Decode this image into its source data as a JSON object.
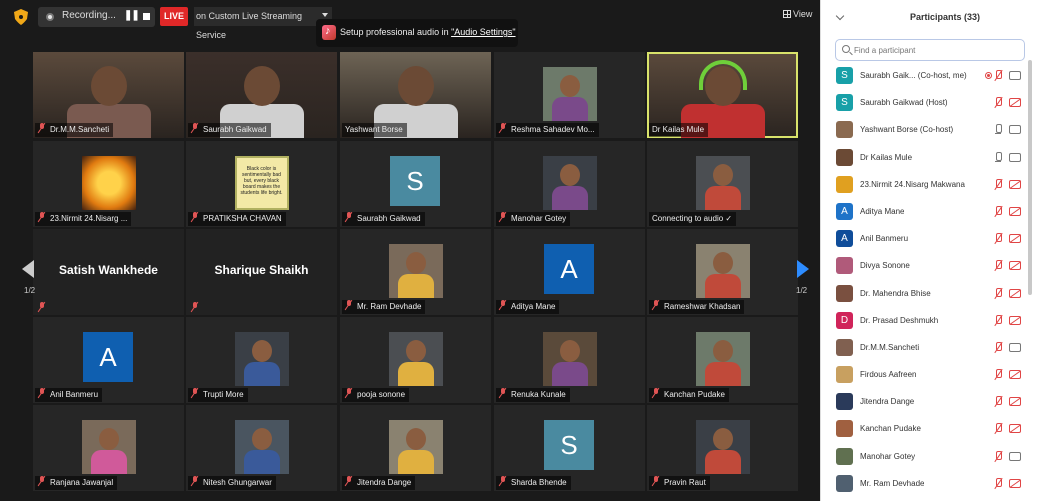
{
  "topbar": {
    "recording_label": "Recording...",
    "live_badge": "LIVE",
    "live_service": "on Custom Live Streaming Service",
    "audio_tip_prefix": "Setup professional audio in",
    "audio_tip_link": "\"Audio Settings\"",
    "view_label": "View"
  },
  "grid": {
    "page_label": "1/2",
    "tiles": [
      {
        "name": "Dr.M.M.Sancheti",
        "kind": "video"
      },
      {
        "name": "Saurabh Gaikwad",
        "kind": "video"
      },
      {
        "name": "Yashwant Borse",
        "kind": "video"
      },
      {
        "name": "Reshma Sahadev Mo...",
        "kind": "photo"
      },
      {
        "name": "Dr Kailas Mule",
        "kind": "video",
        "active": true
      },
      {
        "name": "23.Nirmit 24.Nisarg ...",
        "kind": "photo"
      },
      {
        "name": "PRATIKSHA CHAVAN",
        "kind": "photo"
      },
      {
        "name": "Saurabh Gaikwad",
        "kind": "letter",
        "letter": "S"
      },
      {
        "name": "Manohar Gotey",
        "kind": "photo"
      },
      {
        "name": "Connecting to audio ✓",
        "kind": "photo"
      },
      {
        "name": "Satish Wankhede",
        "kind": "bigname"
      },
      {
        "name": "Sharique Shaikh",
        "kind": "bigname"
      },
      {
        "name": "Mr. Ram Devhade",
        "kind": "photo"
      },
      {
        "name": "Aditya Mane",
        "kind": "letter",
        "letter": "A"
      },
      {
        "name": "Rameshwar Khadsan",
        "kind": "photo"
      },
      {
        "name": "Anil Banmeru",
        "kind": "letter",
        "letter": "A"
      },
      {
        "name": "Trupti More",
        "kind": "photo"
      },
      {
        "name": "pooja sonone",
        "kind": "photo"
      },
      {
        "name": "Renuka Kunale",
        "kind": "photo"
      },
      {
        "name": "Kanchan Pudake",
        "kind": "photo"
      },
      {
        "name": "Ranjana Jawanjal",
        "kind": "photo"
      },
      {
        "name": "Nitesh Ghungarwar",
        "kind": "photo"
      },
      {
        "name": "Jitendra Dange",
        "kind": "photo"
      },
      {
        "name": "Sharda Bhende",
        "kind": "letter",
        "letter": "S"
      },
      {
        "name": "Pravin Raut",
        "kind": "photo"
      }
    ],
    "pratiksha_board_text": "Black color is sentimentally bad but, every black board makes the students life bright."
  },
  "panel": {
    "title": "Participants (33)",
    "search_placeholder": "Find a participant",
    "participants": [
      {
        "name": "Saurabh Gaik...  (Co-host, me)",
        "avatar": "S",
        "avatar_color": "#18a0a8",
        "mic": "red",
        "cam": "gray",
        "rec": true
      },
      {
        "name": "Saurabh Gaikwad (Host)",
        "avatar": "S",
        "avatar_color": "#18a0a8",
        "mic": "red",
        "cam": "red"
      },
      {
        "name": "Yashwant Borse (Co-host)",
        "avatar": "",
        "avatar_color": "#8a6a50",
        "mic": "gray",
        "cam": "gray"
      },
      {
        "name": "Dr Kailas Mule",
        "avatar": "",
        "avatar_color": "#6b4a35",
        "mic": "gray",
        "cam": "gray"
      },
      {
        "name": "23.Nirmit 24.Nisarg Makwana",
        "avatar": "",
        "avatar_color": "#e0a020",
        "mic": "red",
        "cam": "red"
      },
      {
        "name": "Aditya Mane",
        "avatar": "A",
        "avatar_color": "#1e73c8",
        "mic": "red",
        "cam": "red"
      },
      {
        "name": "Anil Banmeru",
        "avatar": "A",
        "avatar_color": "#0f4d9a",
        "mic": "red",
        "cam": "red"
      },
      {
        "name": "Divya Sonone",
        "avatar": "",
        "avatar_color": "#b05a7a",
        "mic": "red",
        "cam": "red"
      },
      {
        "name": "Dr. Mahendra Bhise",
        "avatar": "",
        "avatar_color": "#7a5040",
        "mic": "red",
        "cam": "red"
      },
      {
        "name": "Dr. Prasad Deshmukh",
        "avatar": "D",
        "avatar_color": "#d0245a",
        "mic": "red",
        "cam": "red"
      },
      {
        "name": "Dr.M.M.Sancheti",
        "avatar": "",
        "avatar_color": "#806050",
        "mic": "red",
        "cam": "gray"
      },
      {
        "name": "Firdous Aafreen",
        "avatar": "",
        "avatar_color": "#c8a060",
        "mic": "red",
        "cam": "red"
      },
      {
        "name": "Jitendra Dange",
        "avatar": "",
        "avatar_color": "#2a3a5a",
        "mic": "red",
        "cam": "red"
      },
      {
        "name": "Kanchan Pudake",
        "avatar": "",
        "avatar_color": "#a06040",
        "mic": "red",
        "cam": "red"
      },
      {
        "name": "Manohar Gotey",
        "avatar": "",
        "avatar_color": "#607050",
        "mic": "red",
        "cam": "gray"
      },
      {
        "name": "Mr. Ram Devhade",
        "avatar": "",
        "avatar_color": "#506070",
        "mic": "red",
        "cam": "red"
      }
    ]
  }
}
